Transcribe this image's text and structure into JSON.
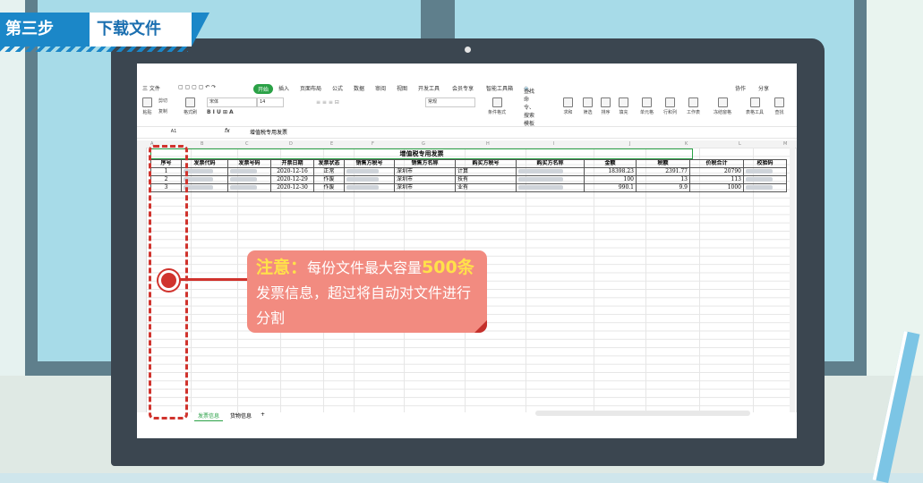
{
  "banner": {
    "step": "第三步",
    "title": "下载文件"
  },
  "ribbon": {
    "menu": "三 文件",
    "tabs": [
      "开始",
      "插入",
      "页面布局",
      "公式",
      "数据",
      "审阅",
      "视图",
      "开发工具",
      "会员专享",
      "智能工具箱"
    ],
    "search": "查找命令、搜索模板",
    "right": [
      "协作",
      "分享"
    ],
    "clipboard": [
      "粘贴",
      "剪切",
      "复制",
      "格式刷"
    ],
    "font_name": "宋体",
    "font_size": "14",
    "number_format": "常规",
    "tools": [
      "条件格式",
      "求和",
      "筛选",
      "排序",
      "填充",
      "单元格",
      "行和列",
      "工作表",
      "冻结窗格",
      "表格工具",
      "查找"
    ]
  },
  "formula_bar": {
    "cell_ref": "A1",
    "fx": "fx",
    "content": "增值税专用发票"
  },
  "columns": [
    "A",
    "B",
    "C",
    "D",
    "E",
    "F",
    "G",
    "H",
    "I",
    "J",
    "K",
    "L",
    "M"
  ],
  "sheet": {
    "title": "增值税专用发票",
    "headers": [
      "序号",
      "发票代码",
      "发票号码",
      "开票日期",
      "发票状态",
      "销售方税号",
      "销售方名称",
      "购买方税号",
      "购买方名称",
      "金额",
      "税额",
      "价税合计",
      "校验码"
    ],
    "rows": [
      [
        "1",
        "",
        "",
        "2020-12-16",
        "正常",
        "",
        "深圳市",
        "计算",
        "",
        "18398.23",
        "2391.77",
        "20790",
        ""
      ],
      [
        "2",
        "",
        "",
        "2020-12-29",
        "作废",
        "",
        "深圳市",
        "技有",
        "",
        "100",
        "13",
        "113",
        ""
      ],
      [
        "3",
        "",
        "",
        "2020-12-30",
        "作废",
        "",
        "深圳市",
        "业有",
        "",
        "990.1",
        "9.9",
        "1000",
        ""
      ]
    ]
  },
  "sheet_tabs": [
    "发票信息",
    "货物信息",
    "+"
  ],
  "note": {
    "label": "注意：",
    "text_a": "每份文件最大容量",
    "highlight": "500条",
    "text_b": "发票信息，超过将自动对文件进行分割"
  },
  "colors": {
    "accent_red": "#d0332d",
    "wps_green": "#2aa146",
    "banner_blue": "#1b87c8",
    "note_bg": "#f28b80"
  }
}
